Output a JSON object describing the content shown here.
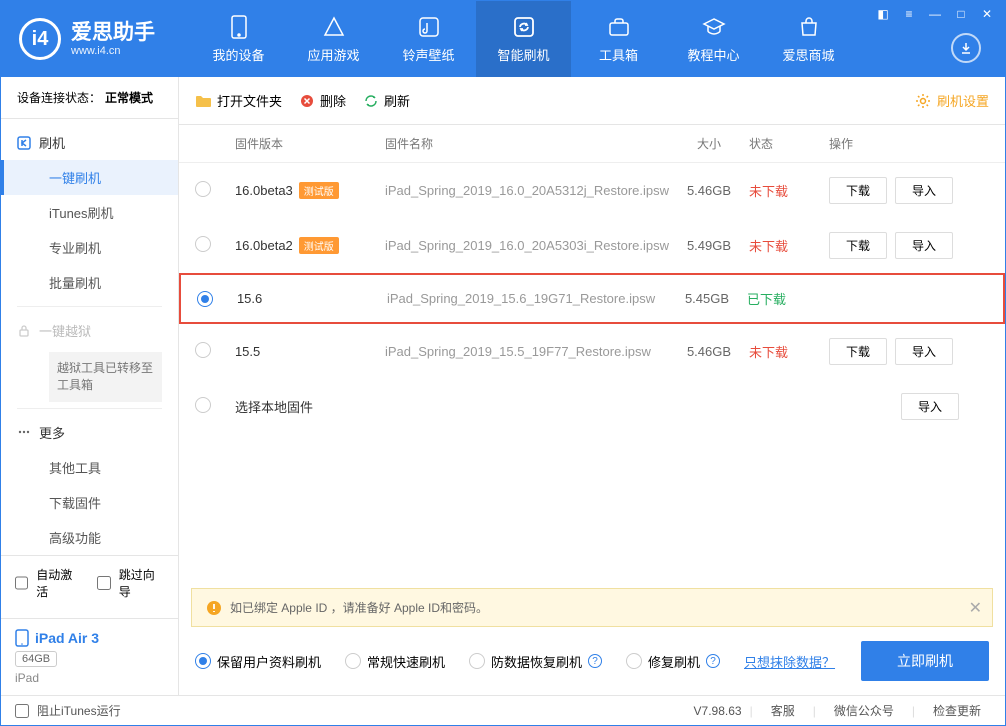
{
  "app": {
    "name": "爱思助手",
    "domain": "www.i4.cn"
  },
  "nav": [
    {
      "label": "我的设备"
    },
    {
      "label": "应用游戏"
    },
    {
      "label": "铃声壁纸"
    },
    {
      "label": "智能刷机",
      "active": true
    },
    {
      "label": "工具箱"
    },
    {
      "label": "教程中心"
    },
    {
      "label": "爱思商城"
    }
  ],
  "sidebar": {
    "status_label": "设备连接状态：",
    "status_value": "正常模式",
    "group_flash": "刷机",
    "items_flash": [
      "一键刷机",
      "iTunes刷机",
      "专业刷机",
      "批量刷机"
    ],
    "group_jailbreak": "一键越狱",
    "jailbreak_note": "越狱工具已转移至工具箱",
    "group_more": "更多",
    "items_more": [
      "其他工具",
      "下载固件",
      "高级功能"
    ],
    "auto_activate": "自动激活",
    "skip_guide": "跳过向导",
    "device_name": "iPad Air 3",
    "device_storage": "64GB",
    "device_type": "iPad"
  },
  "toolbar": {
    "open_folder": "打开文件夹",
    "delete": "删除",
    "refresh": "刷新",
    "settings": "刷机设置"
  },
  "table": {
    "headers": {
      "version": "固件版本",
      "name": "固件名称",
      "size": "大小",
      "status": "状态",
      "ops": "操作"
    },
    "btn_download": "下载",
    "btn_import": "导入",
    "beta_label": "测试版",
    "status_not": "未下载",
    "status_done": "已下载",
    "local_firmware": "选择本地固件",
    "rows": [
      {
        "version": "16.0beta3",
        "beta": true,
        "name": "iPad_Spring_2019_16.0_20A5312j_Restore.ipsw",
        "size": "5.46GB",
        "status": "not",
        "selected": false,
        "ops": true
      },
      {
        "version": "16.0beta2",
        "beta": true,
        "name": "iPad_Spring_2019_16.0_20A5303i_Restore.ipsw",
        "size": "5.49GB",
        "status": "not",
        "selected": false,
        "ops": true
      },
      {
        "version": "15.6",
        "beta": false,
        "name": "iPad_Spring_2019_15.6_19G71_Restore.ipsw",
        "size": "5.45GB",
        "status": "done",
        "selected": true,
        "highlighted": true,
        "ops": false
      },
      {
        "version": "15.5",
        "beta": false,
        "name": "iPad_Spring_2019_15.5_19F77_Restore.ipsw",
        "size": "5.46GB",
        "status": "not",
        "selected": false,
        "ops": true
      }
    ]
  },
  "alert": "如已绑定 Apple ID ，请准备好 Apple ID和密码。",
  "options": {
    "keep_data": "保留用户资料刷机",
    "normal": "常规快速刷机",
    "anti_recovery": "防数据恢复刷机",
    "repair": "修复刷机",
    "erase_link": "只想抹除数据？",
    "flash_now": "立即刷机"
  },
  "footer": {
    "block_itunes": "阻止iTunes运行",
    "version": "V7.98.63",
    "service": "客服",
    "wechat": "微信公众号",
    "update": "检查更新"
  }
}
